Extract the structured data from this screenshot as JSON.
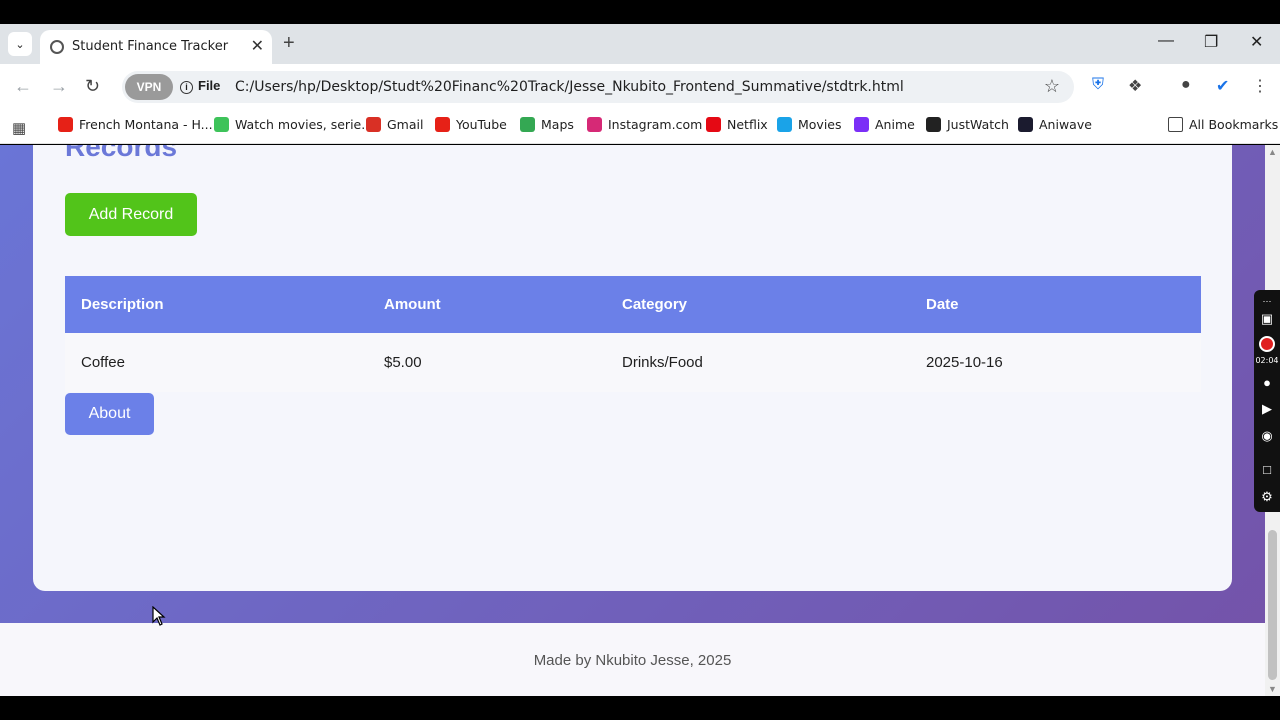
{
  "browser": {
    "tab_title": "Student Finance Tracker",
    "omnibox": {
      "vpn_label": "VPN",
      "file_label": "File",
      "url": "C:/Users/hp/Desktop/Studt%20Financ%20Track/Jesse_Nkubito_Frontend_Summative/stdtrk.html"
    },
    "bookmarks": [
      {
        "label": "French Montana - H...",
        "icon": "youtube-icon",
        "color": "#e62117"
      },
      {
        "label": "Watch movies, serie...",
        "icon": "play-icon",
        "color": "#3ec35a"
      },
      {
        "label": "Gmail",
        "icon": "gmail-icon",
        "color": "#d93025"
      },
      {
        "label": "YouTube",
        "icon": "youtube-icon",
        "color": "#e62117"
      },
      {
        "label": "Maps",
        "icon": "maps-icon",
        "color": "#34a853"
      },
      {
        "label": "Instagram.com",
        "icon": "instagram-icon",
        "color": "#d62976"
      },
      {
        "label": "Netflix",
        "icon": "netflix-icon",
        "color": "#e50914"
      },
      {
        "label": "Movies",
        "icon": "movies-icon",
        "color": "#1aa3e8"
      },
      {
        "label": "Anime",
        "icon": "anime-icon",
        "color": "#7b2ff7"
      },
      {
        "label": "JustWatch",
        "icon": "justwatch-icon",
        "color": "#222222"
      },
      {
        "label": "Aniwave",
        "icon": "aniwave-icon",
        "color": "#1b1b2f"
      }
    ],
    "all_bookmarks": "All Bookmarks"
  },
  "page": {
    "records_title": "Records",
    "add_record_label": "Add Record",
    "table": {
      "headers": [
        "Description",
        "Amount",
        "Category",
        "Date"
      ],
      "rows": [
        [
          "Coffee",
          "$5.00",
          "Drinks/Food",
          "2025-10-16"
        ]
      ]
    },
    "about_label": "About",
    "footer_text": "Made by Nkubito Jesse, 2025"
  },
  "recorder": {
    "time": "02:04"
  },
  "colors": {
    "accent": "#6b80e8",
    "add_button": "#52c41a",
    "title": "#6b78d8",
    "gradient_start": "#6a75d6",
    "gradient_end": "#7452a8"
  }
}
